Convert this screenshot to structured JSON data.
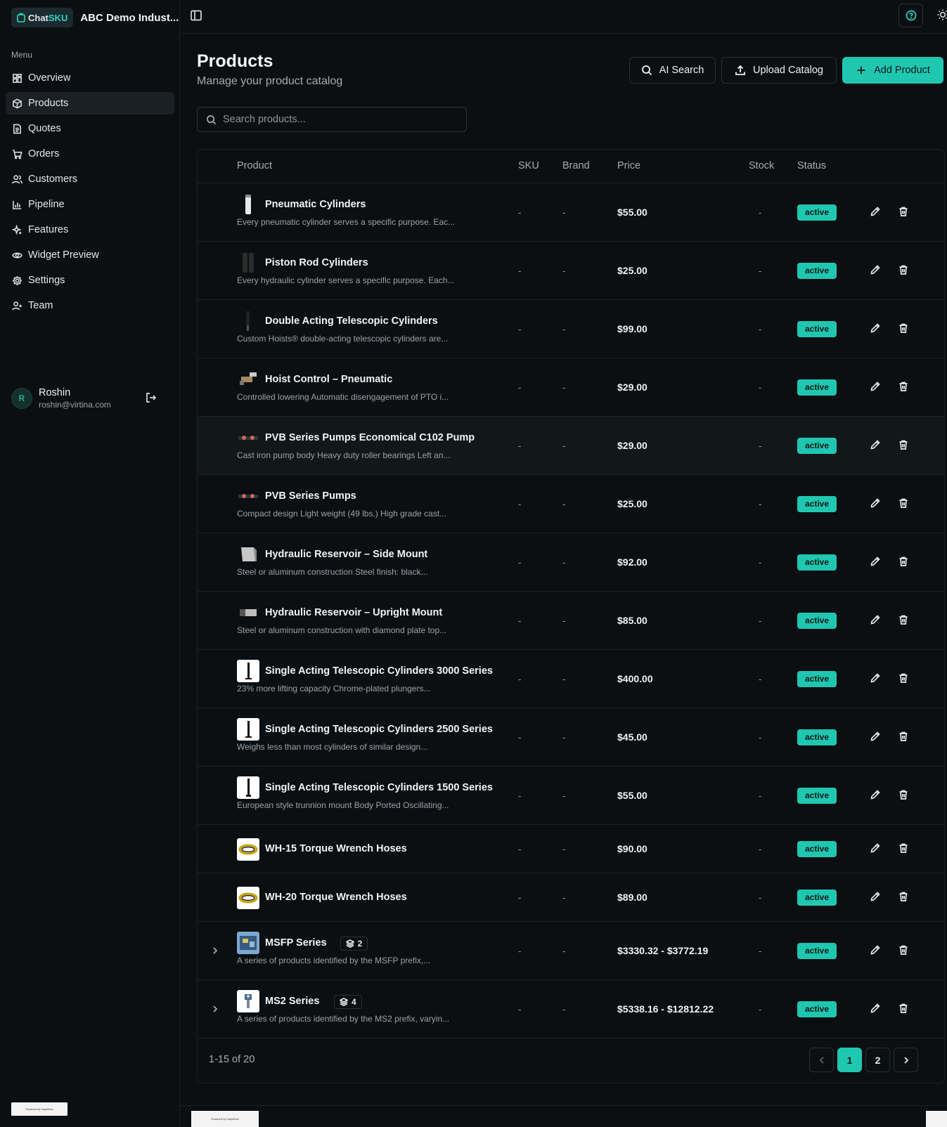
{
  "app": {
    "logo_prefix": "Chat",
    "logo_suffix": "SKU",
    "org_name": "ABC Demo Indust..."
  },
  "sidebar": {
    "menu_title": "Menu",
    "items": [
      {
        "label": "Overview",
        "icon": "grid-icon",
        "active": false
      },
      {
        "label": "Products",
        "icon": "package-icon",
        "active": true
      },
      {
        "label": "Quotes",
        "icon": "document-icon",
        "active": false
      },
      {
        "label": "Orders",
        "icon": "cart-icon",
        "active": false
      },
      {
        "label": "Customers",
        "icon": "users-icon",
        "active": false
      },
      {
        "label": "Pipeline",
        "icon": "bar-chart-icon",
        "active": false
      },
      {
        "label": "Features",
        "icon": "sparkles-icon",
        "active": false
      },
      {
        "label": "Widget Preview",
        "icon": "eye-icon",
        "active": false
      },
      {
        "label": "Settings",
        "icon": "gear-icon",
        "active": false
      },
      {
        "label": "Team",
        "icon": "user-plus-icon",
        "active": false
      }
    ],
    "user": {
      "initial": "R",
      "name": "Roshin",
      "email": "roshin@virtina.com"
    },
    "footer_badge": "Powered by ImpelHub"
  },
  "header": {
    "title": "Products",
    "subtitle": "Manage your product catalog",
    "ai_search_label": "AI Search",
    "upload_label": "Upload Catalog",
    "add_label": "Add Product"
  },
  "search": {
    "placeholder": "Search products...",
    "value": ""
  },
  "table": {
    "columns": {
      "product": "Product",
      "sku": "SKU",
      "brand": "Brand",
      "price": "Price",
      "stock": "Stock",
      "status": "Status"
    },
    "rows": [
      {
        "name": "Pneumatic Cylinders",
        "desc": "Every pneumatic cylinder serves a specific purpose. Eac...",
        "sku": "-",
        "brand": "-",
        "price": "$55.00",
        "stock": "-",
        "status": "active"
      },
      {
        "name": "Piston Rod Cylinders",
        "desc": "Every hydraulic cylinder serves a specific purpose. Each...",
        "sku": "-",
        "brand": "-",
        "price": "$25.00",
        "stock": "-",
        "status": "active"
      },
      {
        "name": "Double Acting Telescopic Cylinders",
        "desc": "Custom Hoists® double-acting telescopic cylinders are...",
        "sku": "-",
        "brand": "-",
        "price": "$99.00",
        "stock": "-",
        "status": "active"
      },
      {
        "name": "Hoist Control – Pneumatic",
        "desc": "Controlled lowering Automatic disengagement of PTO i...",
        "sku": "-",
        "brand": "-",
        "price": "$29.00",
        "stock": "-",
        "status": "active"
      },
      {
        "name": "PVB Series Pumps Economical C102 Pump",
        "desc": "Cast iron pump body Heavy duty roller bearings Left an...",
        "sku": "-",
        "brand": "-",
        "price": "$29.00",
        "stock": "-",
        "status": "active"
      },
      {
        "name": "PVB Series Pumps",
        "desc": "Compact design Light weight (49 lbs.) High grade cast...",
        "sku": "-",
        "brand": "-",
        "price": "$25.00",
        "stock": "-",
        "status": "active"
      },
      {
        "name": "Hydraulic Reservoir – Side Mount",
        "desc": "Steel or aluminum construction Steel finish: black...",
        "sku": "-",
        "brand": "-",
        "price": "$92.00",
        "stock": "-",
        "status": "active"
      },
      {
        "name": "Hydraulic Reservoir – Upright Mount",
        "desc": "Steel or aluminum construction with diamond plate top...",
        "sku": "-",
        "brand": "-",
        "price": "$85.00",
        "stock": "-",
        "status": "active"
      },
      {
        "name": "Single Acting Telescopic Cylinders 3000 Series",
        "desc": "23% more lifting capacity Chrome-plated plungers...",
        "sku": "-",
        "brand": "-",
        "price": "$400.00",
        "stock": "-",
        "status": "active"
      },
      {
        "name": "Single Acting Telescopic Cylinders 2500 Series",
        "desc": "Weighs less than most cylinders of similar design...",
        "sku": "-",
        "brand": "-",
        "price": "$45.00",
        "stock": "-",
        "status": "active"
      },
      {
        "name": "Single Acting Telescopic Cylinders 1500 Series",
        "desc": "European style trunnion mount Body Ported Oscillating...",
        "sku": "-",
        "brand": "-",
        "price": "$55.00",
        "stock": "-",
        "status": "active"
      },
      {
        "name": "WH-15 Torque Wrench Hoses",
        "desc": "",
        "sku": "-",
        "brand": "-",
        "price": "$90.00",
        "stock": "-",
        "status": "active"
      },
      {
        "name": "WH-20 Torque Wrench Hoses",
        "desc": "",
        "sku": "-",
        "brand": "-",
        "price": "$89.00",
        "stock": "-",
        "status": "active"
      },
      {
        "name": "MSFP Series",
        "variants": "2",
        "desc": "A series of products identified by the MSFP prefix,...",
        "sku": "-",
        "brand": "-",
        "price": "$3330.32 - $3772.19",
        "stock": "-",
        "status": "active"
      },
      {
        "name": "MS2 Series",
        "variants": "4",
        "desc": "A series of products identified by the MS2 prefix, varyin...",
        "sku": "-",
        "brand": "-",
        "price": "$5338.16 - $12812.22",
        "stock": "-",
        "status": "active"
      }
    ],
    "footer": {
      "count": "1-15 of 20",
      "pages": [
        "1",
        "2"
      ],
      "current_page": "1"
    }
  },
  "colors": {
    "accent": "#20c7b0",
    "background": "#0b0f12",
    "border": "#1c2226"
  }
}
